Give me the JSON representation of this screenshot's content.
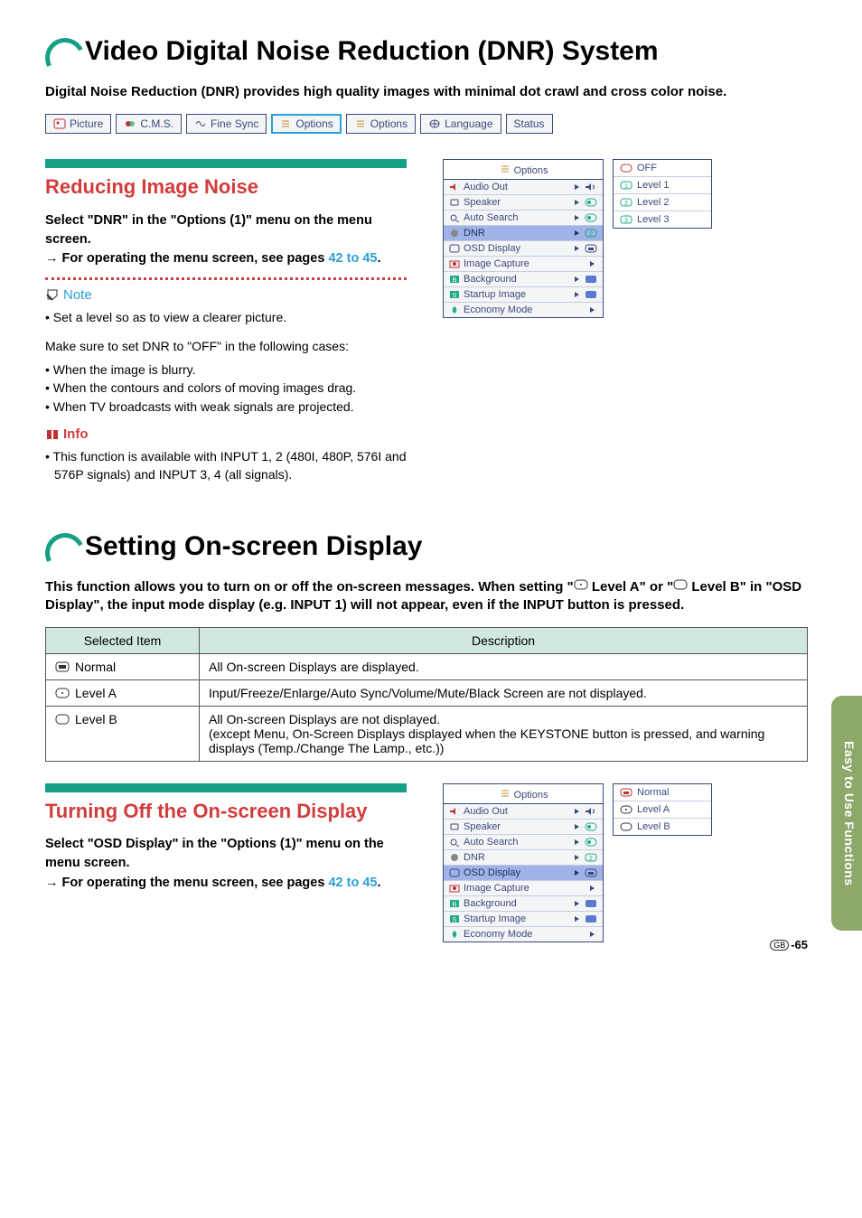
{
  "section1": {
    "title": "Video Digital Noise Reduction (DNR) System",
    "intro": "Digital Noise Reduction (DNR) provides high quality images with minimal dot crawl and cross color noise.",
    "menu": [
      "Picture",
      "C.M.S.",
      "Fine Sync",
      "Options",
      "Options",
      "Language",
      "Status"
    ],
    "sub": {
      "heading": "Reducing Image Noise",
      "select_line_a": "Select \"DNR\" in the \"Options (1)\" menu on the menu screen.",
      "operate_prefix": "→ For operating the menu screen, see pages ",
      "operate_link": "42 to 45",
      "operate_suffix": ".",
      "note_label": "Note",
      "note_bullet1": "Set a level so as to view a clearer picture.",
      "note_plain": "Make sure to set DNR to \"OFF\" in the following cases:",
      "note_b2": "When the image is blurry.",
      "note_b3": "When the contours and colors of moving images drag.",
      "note_b4": "When TV broadcasts with weak signals are projected.",
      "info_label": "Info",
      "info_text": "This function is available with INPUT 1, 2 (480I, 480P, 576I and 576P signals) and INPUT 3, 4 (all signals)."
    },
    "osd": {
      "title": "Options",
      "rows": [
        "Audio Out",
        "Speaker",
        "Auto Search",
        "DNR",
        "OSD Display",
        "Image Capture",
        "Background",
        "Startup Image",
        "Economy Mode"
      ],
      "hl_index": 3
    },
    "dnr_levels": [
      "OFF",
      "Level 1",
      "Level 2",
      "Level 3"
    ]
  },
  "section2": {
    "title": "Setting On-screen Display",
    "intro_a": "This function allows you to turn on or off the on-screen messages. When setting \"",
    "intro_b": " Level A\" or \"",
    "intro_c": " Level B\" in \"OSD Display\", the input mode display (e.g. INPUT 1) will not appear, even if the INPUT button is pressed.",
    "table": {
      "h1": "Selected Item",
      "h2": "Description",
      "rows": [
        {
          "item": "Normal",
          "desc": "All On-screen Displays are displayed."
        },
        {
          "item": "Level A",
          "desc": "Input/Freeze/Enlarge/Auto Sync/Volume/Mute/Black Screen are not displayed."
        },
        {
          "item": "Level B",
          "desc": "All On-screen Displays are not displayed.\n(except Menu, On-Screen Displays displayed when the KEYSTONE button is pressed, and warning displays (Temp./Change The Lamp., etc.))"
        }
      ]
    },
    "sub": {
      "heading": "Turning Off the On-screen Display",
      "select_line": "Select \"OSD Display\" in the \"Options (1)\" menu on the menu screen.",
      "operate_prefix": "→ For operating the menu screen, see pages ",
      "operate_link": "42 to 45",
      "operate_suffix": "."
    },
    "osd": {
      "title": "Options",
      "rows": [
        "Audio Out",
        "Speaker",
        "Auto Search",
        "DNR",
        "OSD Display",
        "Image Capture",
        "Background",
        "Startup Image",
        "Economy Mode"
      ],
      "hl_index": 4
    },
    "osd_levels": [
      "Normal",
      "Level A",
      "Level B"
    ]
  },
  "side_tab": "Easy to Use Functions",
  "page_label": "GB",
  "page_num": "-65"
}
